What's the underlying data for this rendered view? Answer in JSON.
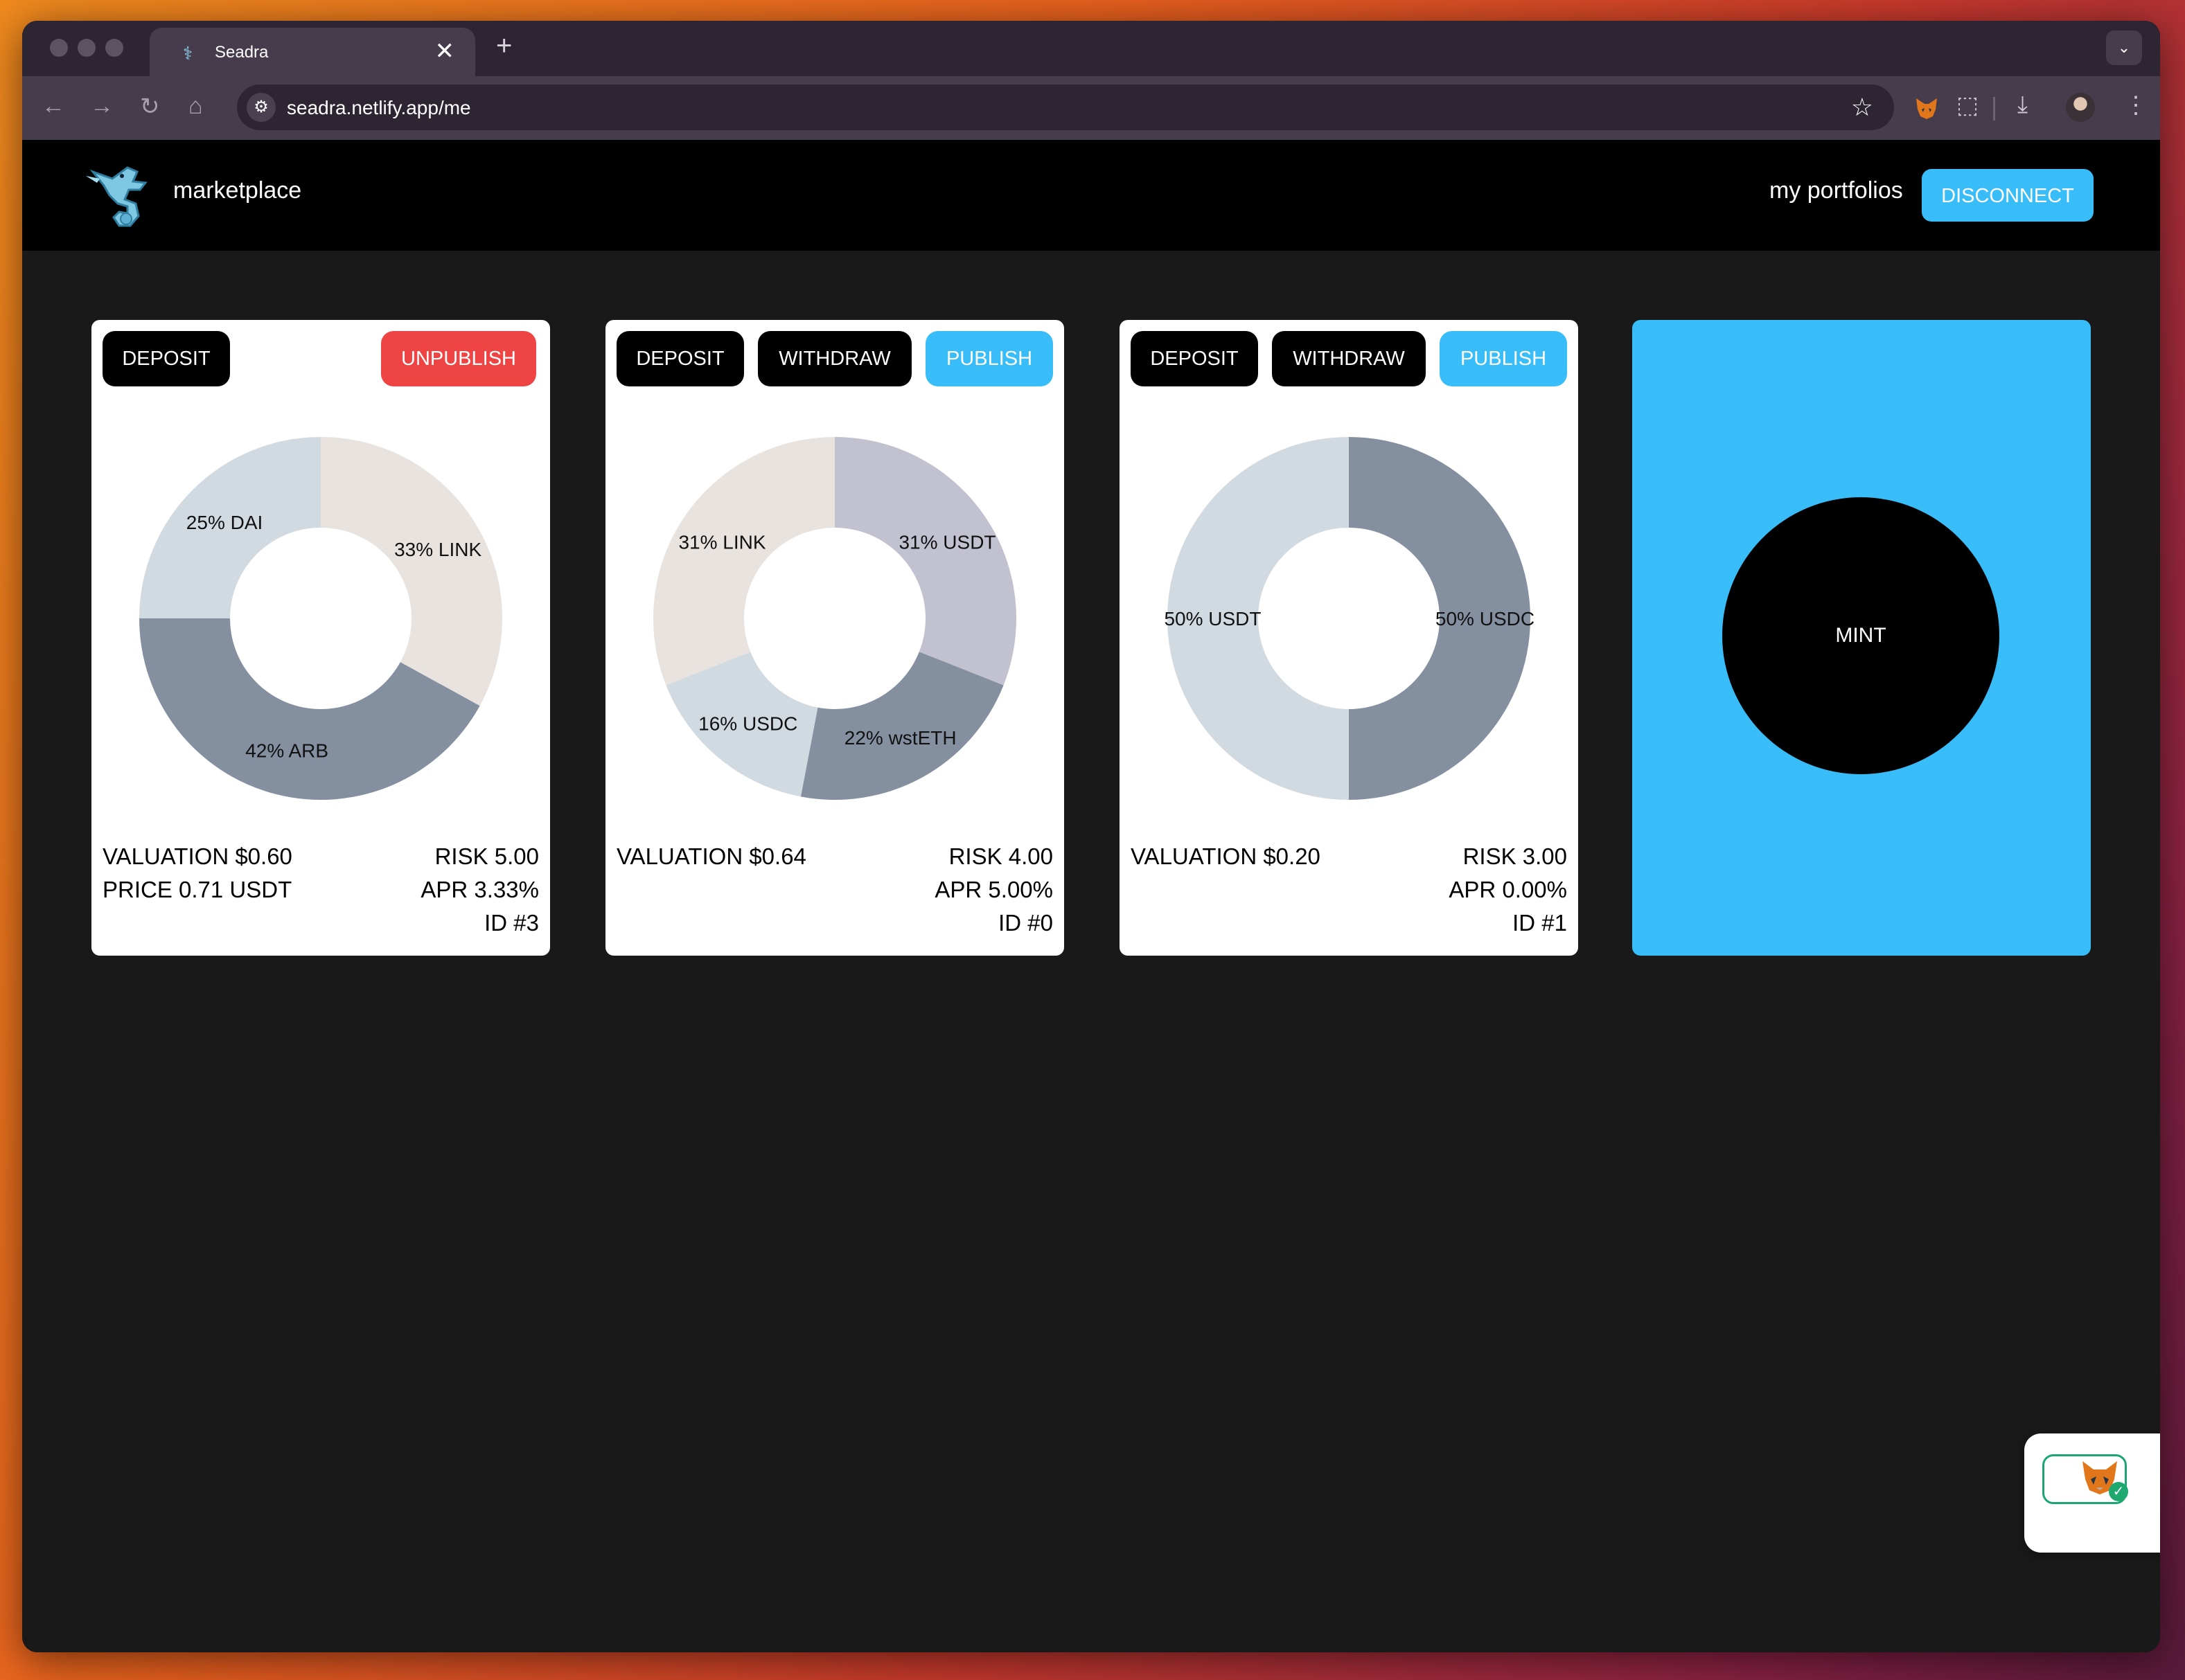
{
  "browser": {
    "tab_title": "Seadra",
    "tab_close": "✕",
    "new_tab": "+",
    "tab_menu": "⌄",
    "url": "seadra.netlify.app/me",
    "icons": {
      "back": "←",
      "forward": "→",
      "reload": "↻",
      "home": "⌂",
      "site_info": "⚙",
      "star": "☆",
      "extension": "⬚",
      "download": "⤓",
      "menu": "⋮"
    }
  },
  "header": {
    "brand": "marketplace",
    "nav_link": "my portfolios",
    "disconnect": "DISCONNECT"
  },
  "portfolios": [
    {
      "buttons": {
        "deposit": "DEPOSIT",
        "unpublish": "UNPUBLISH"
      },
      "slices": [
        {
          "label": "33% LINK",
          "percent": 33,
          "color": "#e8e3df"
        },
        {
          "label": "42% ARB",
          "percent": 42,
          "color": "#84909f"
        },
        {
          "label": "25% DAI",
          "percent": 25,
          "color": "#d1d9e1"
        }
      ],
      "valuation": "VALUATION $0.60",
      "price": "PRICE 0.71 USDT",
      "risk": "RISK 5.00",
      "apr": "APR 3.33%",
      "id": "ID #3"
    },
    {
      "buttons": {
        "deposit": "DEPOSIT",
        "withdraw": "WITHDRAW",
        "publish": "PUBLISH"
      },
      "slices": [
        {
          "label": "31% USDT",
          "percent": 31,
          "color": "#c2c1d0"
        },
        {
          "label": "22% wstETH",
          "percent": 22,
          "color": "#84909f"
        },
        {
          "label": "16% USDC",
          "percent": 16,
          "color": "#d1d9e1"
        },
        {
          "label": "31% LINK",
          "percent": 31,
          "color": "#e8e3df"
        }
      ],
      "valuation": "VALUATION $0.64",
      "risk": "RISK 4.00",
      "apr": "APR 5.00%",
      "id": "ID #0"
    },
    {
      "buttons": {
        "deposit": "DEPOSIT",
        "withdraw": "WITHDRAW",
        "publish": "PUBLISH"
      },
      "slices": [
        {
          "label": "50% USDC",
          "percent": 50,
          "color": "#84909f"
        },
        {
          "label": "50% USDT",
          "percent": 50,
          "color": "#d1d9e1"
        }
      ],
      "valuation": "VALUATION $0.20",
      "risk": "RISK 3.00",
      "apr": "APR 0.00%",
      "id": "ID #1"
    }
  ],
  "mint": {
    "label": "MINT"
  },
  "colors": {
    "accent": "#38bdf8",
    "danger": "#ef4444",
    "background": "#191919",
    "header": "#000000"
  }
}
